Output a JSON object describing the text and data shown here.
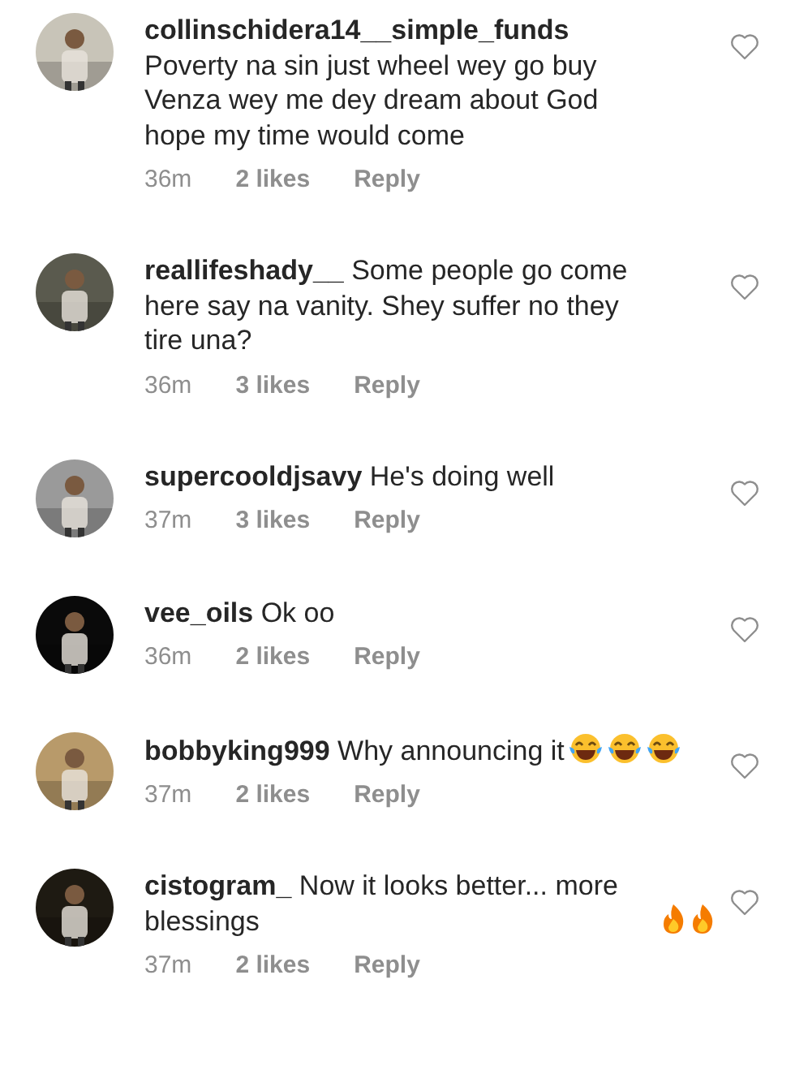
{
  "comments": [
    {
      "text": "**collinschidera14__simple_funds** Poverty na sin just wheel wey go buy Venza wey me dey dream about God hope my time would come",
      "time": "36m",
      "likes": "2 likes",
      "reply": "Reply",
      "liked": false
    },
    {
      "text": "**reallifeshady__** Some people go come here say na vanity. Shey suffer no they tire una?",
      "time": "36m",
      "likes": "3 likes",
      "reply": "Reply",
      "liked": false
    },
    {
      "text": "**supercooldjsavy** He's doing well",
      "time": "37m",
      "likes": "3 likes",
      "reply": "Reply",
      "liked": false
    },
    {
      "text": "**vee_oils** Ok oo",
      "time": "36m",
      "likes": "2 likes",
      "reply": "Reply",
      "liked": false
    },
    {
      "text": "**bobbyking999** Why announcing it",
      "emojis": [
        {
          "kind": "laugh"
        },
        {
          "kind": "laugh"
        },
        {
          "kind": "laugh"
        }
      ],
      "time": "37m",
      "likes": "2 likes",
      "reply": "Reply",
      "liked": false
    },
    {
      "text": "**cistogram_** Now it looks better... more blessings",
      "emojis": [
        {
          "kind": "fire"
        },
        {
          "kind": "fire"
        }
      ],
      "time": "37m",
      "likes": "2 likes",
      "reply": "Reply",
      "liked": false
    }
  ]
}
